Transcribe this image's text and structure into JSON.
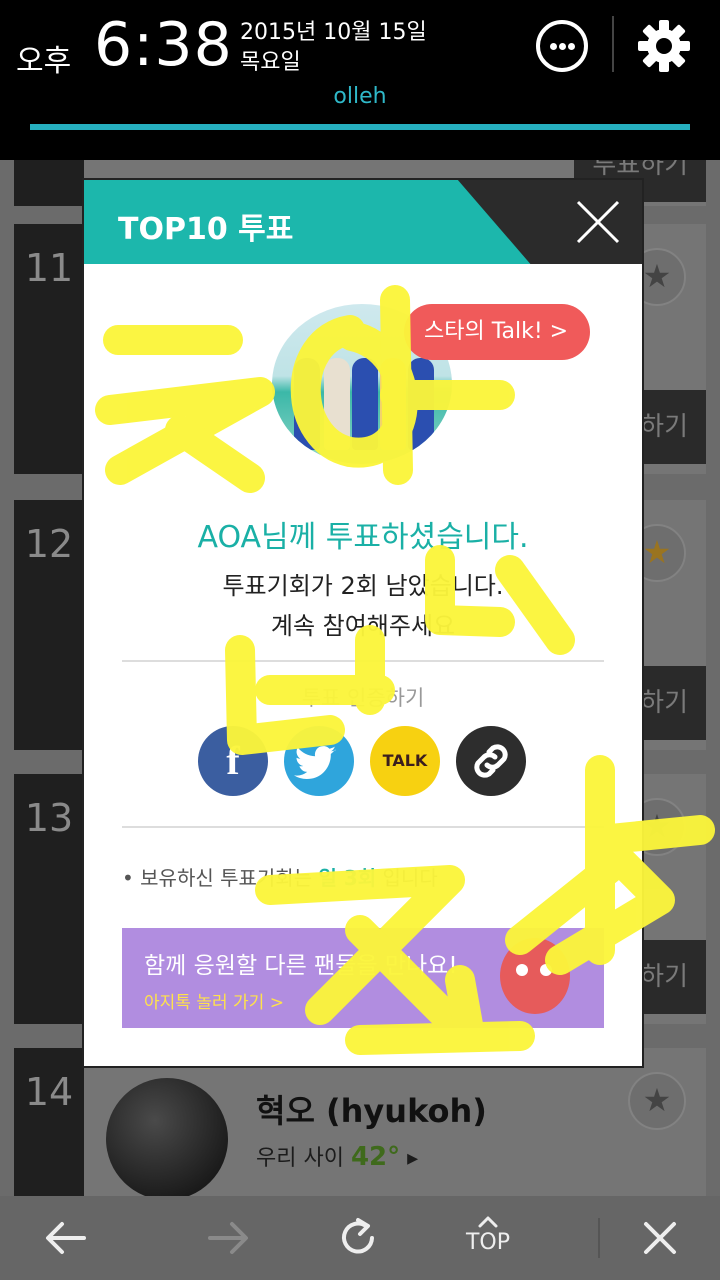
{
  "status_bar": {
    "ampm": "오후",
    "time": "6:38",
    "date": "2015년 10월 15일",
    "weekday": "목요일",
    "carrier": "olleh"
  },
  "list": {
    "vote_label": "하기",
    "vote_label_top": "투표하기",
    "items": [
      {
        "rank": "11"
      },
      {
        "rank": "12"
      },
      {
        "rank": "13"
      },
      {
        "rank": "14",
        "name": "혁오 (hyukoh)",
        "temp_label": "우리 사이",
        "temp_value": "42°"
      }
    ]
  },
  "modal": {
    "title": "TOP10 투표",
    "talk_badge": "스타의 Talk! >",
    "voted_message": "AOA님께 투표하셨습니다.",
    "remaining_message": "투표기회가 2회 남았습니다.",
    "continue_message": "계속 참여해주세요",
    "share_label": "투표 인증하기",
    "share_buttons": [
      "f",
      "twitter-bird",
      "TALK",
      "link"
    ],
    "remaining_note_prefix": "• 보유하신 투표기회는 ",
    "remaining_note_value": "일 3회",
    "remaining_note_suffix": " 입니다",
    "promo_title": "함께 응원할 다른 팬들을 만나요!",
    "promo_link": "아지톡 놀러 가기 >"
  },
  "toolbar": {
    "top_label": "TOP"
  },
  "colors": {
    "accent_teal": "#1cb7ac",
    "talk_red": "#f05a5a",
    "promo_purple": "#b18de0",
    "scribble_yellow": "#fbf53b"
  }
}
